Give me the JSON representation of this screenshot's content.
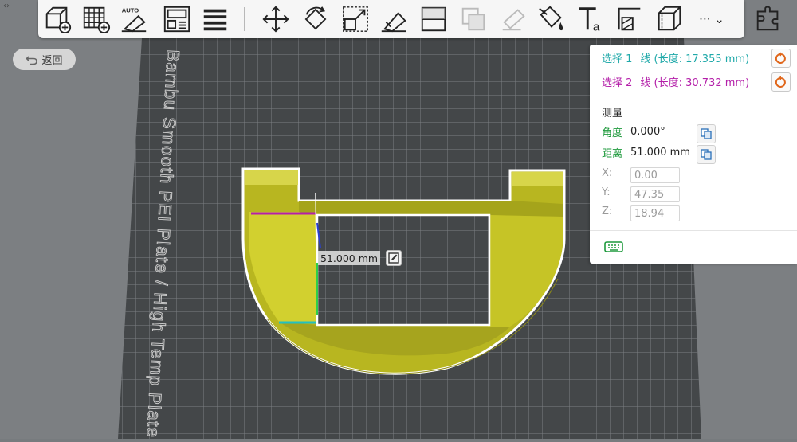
{
  "plate": {
    "label": "Bambu Smooth PEI Plate / High Temp Plate"
  },
  "nav": {
    "back_label": "返回"
  },
  "toolbar": {
    "tools": [
      {
        "name": "add-object-icon"
      },
      {
        "name": "add-plate-icon"
      },
      {
        "name": "auto-orient-icon",
        "badge": "AUTO"
      },
      {
        "name": "arrange-icon"
      },
      {
        "name": "layers-icon"
      },
      {
        "name": "move-icon"
      },
      {
        "name": "rotate-icon"
      },
      {
        "name": "scale-icon"
      },
      {
        "name": "lay-on-face-icon"
      },
      {
        "name": "cut-icon"
      },
      {
        "name": "boolean-icon"
      },
      {
        "name": "support-paint-icon"
      },
      {
        "name": "color-paint-icon"
      },
      {
        "name": "text-icon"
      },
      {
        "name": "seam-icon"
      },
      {
        "name": "measure-icon"
      },
      {
        "name": "more-icon",
        "label": "··· ⌄"
      },
      {
        "name": "assembly-icon"
      }
    ]
  },
  "panel": {
    "selection1": {
      "label": "选择 1",
      "desc": "线 (长度: 17.355 mm)",
      "color": "#1fa9a9"
    },
    "selection2": {
      "label": "选择 2",
      "desc": "线 (长度: 30.732 mm)",
      "color": "#b41fa9"
    },
    "measure_title": "测量",
    "angle": {
      "label": "角度",
      "value": "0.000°"
    },
    "distance": {
      "label": "距离",
      "value": "51.000 mm"
    },
    "x": {
      "label": "X:",
      "value": "0.00"
    },
    "y": {
      "label": "Y:",
      "value": "47.35"
    },
    "z": {
      "label": "Z:",
      "value": "18.94"
    }
  },
  "viewport": {
    "distance_label": "51.000 mm"
  },
  "colors": {
    "model": "#c9c82c",
    "accent_green": "#1f9a3d",
    "reset_orange": "#e0661a"
  }
}
